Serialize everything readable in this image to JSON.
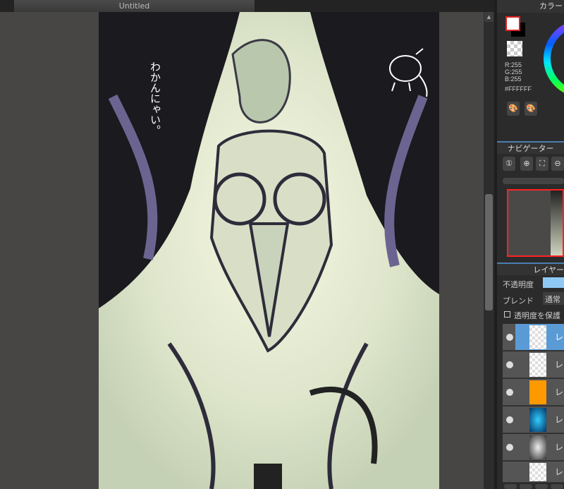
{
  "document": {
    "tab_title": "Untitled",
    "canvas_text": "わかんにゃい。"
  },
  "color_panel": {
    "title": "カラー",
    "r": "R:255",
    "g": "G:255",
    "b": "B:255",
    "hex": "#FFFFFF",
    "foreground": "#FFFFFF",
    "background": "#000000"
  },
  "navigator_panel": {
    "title": "ナビゲーター"
  },
  "layer_panel": {
    "title": "レイヤー",
    "opacity_label": "不透明度",
    "blend_label": "ブレンド",
    "blend_value": "通常",
    "protect_alpha_label": "透明度を保護",
    "layers": [
      {
        "name": "レ",
        "thumb": "transparent",
        "selected": true
      },
      {
        "name": "レ",
        "thumb": "transparent"
      },
      {
        "name": "レ",
        "thumb": "#FF9900"
      },
      {
        "name": "レ",
        "thumb": "blue-art"
      },
      {
        "name": "レ",
        "thumb": "bw-art"
      },
      {
        "name": "レ",
        "thumb": "transparent"
      }
    ]
  }
}
